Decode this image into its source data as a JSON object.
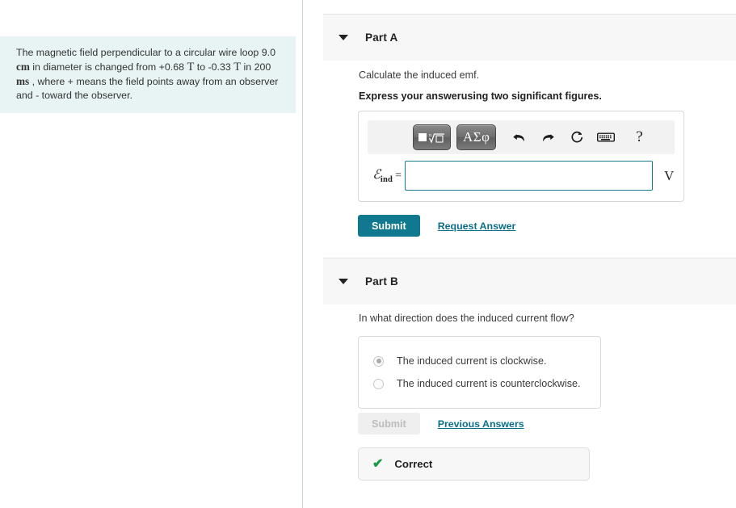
{
  "problem": {
    "line1": "The magnetic field perpendicular to a circular wire loop",
    "value_diameter": "9.0",
    "unit_cm": "cm",
    "line2_mid": "in diameter is changed from +0.68",
    "unit_T1": "T",
    "line2_to": "to -0.33",
    "unit_T2": "T",
    "line3_pre": "in 200",
    "unit_ms": "ms",
    "line3_post": ", where + means the field points away from an observer and - toward the observer."
  },
  "partA": {
    "title": "Part A",
    "caret_icon": "chevron-down-icon",
    "prompt": "Calculate the induced emf.",
    "prompt_bold": "Express your answerusing two significant figures.",
    "toolbar": {
      "template_button": "math-template-icon",
      "greek_button": "ΑΣφ",
      "undo_icon": "undo-icon",
      "redo_icon": "redo-icon",
      "reset_icon": "reset-icon",
      "keyboard_icon": "keyboard-icon",
      "help_icon": "?"
    },
    "field_label_symbol": "ℰ",
    "field_label_sub": "ind",
    "field_label_eq": "=",
    "input_value": "",
    "input_placeholder": "",
    "unit": "V",
    "submit_label": "Submit",
    "request_answer_label": "Request Answer"
  },
  "partB": {
    "title": "Part B",
    "caret_icon": "chevron-down-icon",
    "prompt": "In what direction does the induced current flow?",
    "choices": [
      {
        "label": "The induced current is clockwise.",
        "selected": true
      },
      {
        "label": "The induced current is counterclockwise.",
        "selected": false
      }
    ],
    "submit_label": "Submit",
    "submit_disabled": true,
    "previous_answers_label": "Previous Answers",
    "feedback_icon": "check-icon",
    "feedback_label": "Correct"
  },
  "colors": {
    "problem_bg": "#e8f4f3",
    "accent_teal": "#10788f",
    "link": "#0a6e8a",
    "header_bg": "#f7f7f7",
    "correct_green": "#139a43",
    "input_border": "#1b7b8f"
  }
}
